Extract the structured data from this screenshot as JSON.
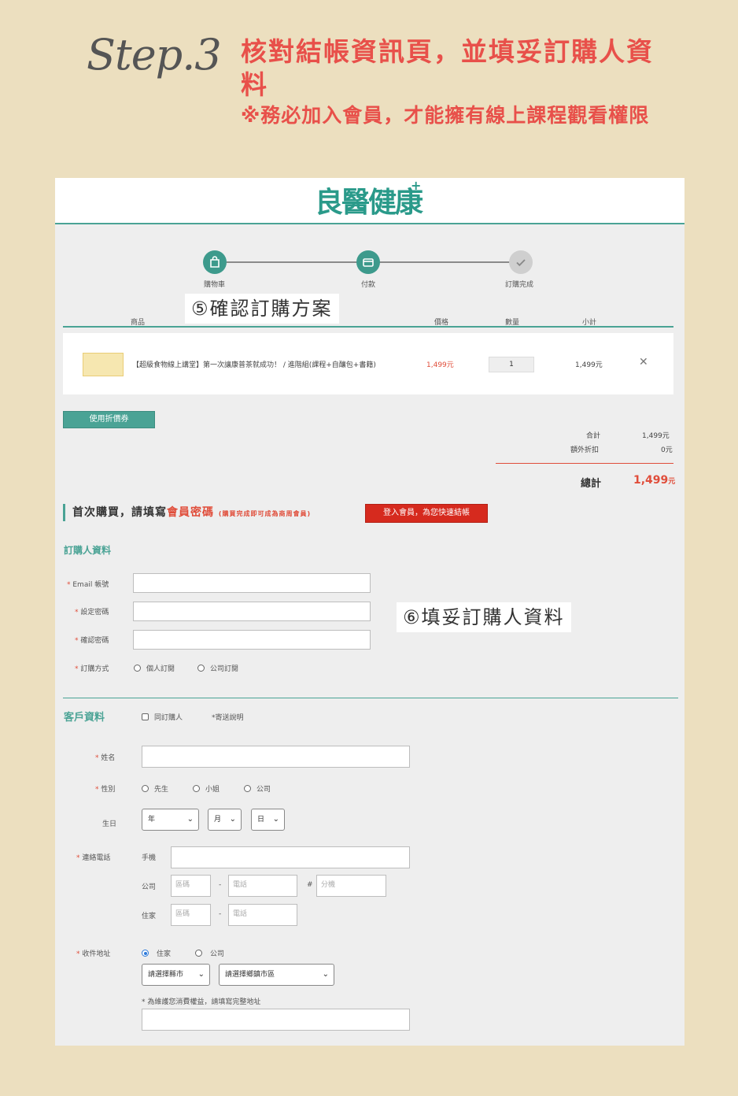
{
  "header": {
    "step": "Step.3",
    "title": "核對結帳資訊頁，並填妥訂購人資料",
    "note": "※務必加入會員，才能擁有線上課程觀看權限"
  },
  "logo": {
    "text": "良醫健康",
    "plus": "+"
  },
  "progress": {
    "steps": [
      {
        "label": "購物車"
      },
      {
        "label": "付款"
      },
      {
        "label": "訂購完成"
      }
    ]
  },
  "callouts": {
    "c5": "⑤確認訂購方案",
    "c6": "⑥填妥訂購人資料"
  },
  "cart": {
    "headers": {
      "product": "商品",
      "price": "價格",
      "qty": "數量",
      "subtotal": "小計"
    },
    "item": {
      "name": "【超級食物線上講堂】第一次讓康普茶就成功！ / 進階組(課程+自釀包+書籍)",
      "price": "1,499元",
      "qty": "1",
      "subtotal": "1,499元"
    },
    "coupon_button": "使用折價券",
    "summary": {
      "sum_label": "合計",
      "sum_value": "1,499元",
      "discount_label": "額外折扣",
      "discount_value": "0元",
      "total_label": "總計",
      "total_value": "1,499",
      "total_unit": "元"
    }
  },
  "member": {
    "prefix": "首次購買，請填寫",
    "highlight": "會員密碼",
    "small": "(購買完成即可成為商周會員)",
    "login_button": "登入會員，為您快速結帳"
  },
  "buyer": {
    "title": "訂購人資料",
    "email_label": "Email 帳號",
    "password_label": "設定密碼",
    "confirm_label": "確認密碼",
    "method_label": "訂購方式",
    "method_personal": "個人訂閱",
    "method_company": "公司訂閱"
  },
  "customer": {
    "title": "客戶資料",
    "same_label": "同訂購人",
    "shipping_note": "*寄送說明",
    "name_label": "姓名",
    "gender_label": "性別",
    "gender_mr": "先生",
    "gender_ms": "小姐",
    "gender_company": "公司",
    "birthday_label": "生日",
    "year": "年",
    "month": "月",
    "day": "日",
    "phone_label": "連絡電話",
    "mobile_label": "手機",
    "office_label": "公司",
    "home_label": "住家",
    "area_placeholder": "區碼",
    "tel_placeholder": "電話",
    "ext_placeholder": "分機",
    "dash": "-",
    "hash": "#",
    "address_label": "收件地址",
    "addr_home": "住家",
    "addr_company": "公司",
    "city_select": "請選擇縣市",
    "district_select": "請選擇鄉鎮市區",
    "address_note": "* 為維護您消費權益，請填寫完整地址"
  },
  "icons": {
    "check": "check-icon",
    "cart": "bag-icon",
    "card": "card-icon",
    "close": "close-icon",
    "chev": "chevron-down-icon"
  },
  "colors": {
    "accent": "#4aa395",
    "red": "#e04d3a",
    "bg": "#ecdfbf"
  }
}
